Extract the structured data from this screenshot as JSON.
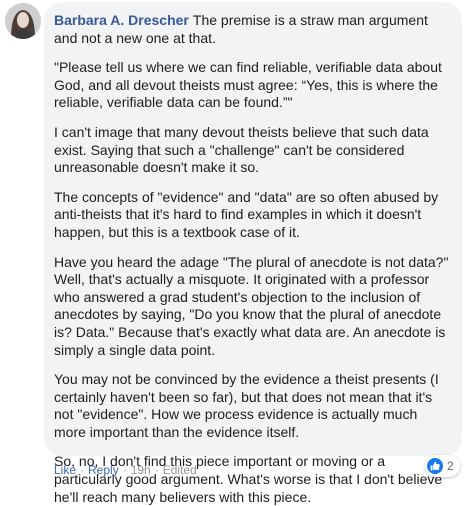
{
  "comment": {
    "author": "Barbara A. Drescher",
    "first_paragraph": "The premise is a straw man argument and not a new one at that.",
    "paragraphs": [
      "\"Please tell us where we can find reliable, verifiable data about God, and all devout theists must agree: “Yes, this is where the reliable, verifiable data can be found.”\"",
      "I can't image that many devout theists believe that such data exist. Saying that such a \"challenge\" can't be considered unreasonable doesn't make it so.",
      "The concepts of \"evidence\" and \"data\" are so often abused by anti-theists that it's hard to find examples in which it doesn't happen, but this is a textbook case of it.",
      "Have you heard the adage \"The plural of anecdote is not data?\" Well, that's actually a misquote. It originated with a professor who answered a grad student's objection to the inclusion of anecdotes by saying, \"Do you know that the plural of anecdote is? Data.\" Because that's exactly what data are. An anecdote is simply a single data point.",
      "You may not be convinced by the evidence a theist presents (I certainly haven't been so far), but that does not mean that it's not \"evidence\". How we process evidence is actually much more important than the evidence itself.",
      "So, no, I don't find this piece important or moving or a particularly good argument. What's worse is that I don't believe he'll reach many believers with this piece."
    ]
  },
  "actions": {
    "like": "Like",
    "reply": "Reply",
    "time": "19h",
    "edited": "Edited",
    "separator": "·"
  },
  "reactions": {
    "count": "2",
    "icon": "thumbs-up-icon",
    "color": "#1877f2"
  }
}
